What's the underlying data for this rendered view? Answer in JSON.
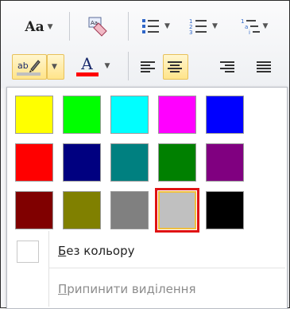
{
  "ribbon": {
    "font_size_label": "Aa",
    "font_color_letter": "A",
    "highlighter_label": "ab",
    "font_color_bar": "#ff0000",
    "highlight_bar": "#c0c0c0"
  },
  "palette": {
    "rows": [
      [
        {
          "name": "yellow",
          "color": "#ffff00"
        },
        {
          "name": "bright-green",
          "color": "#00ff00"
        },
        {
          "name": "turquoise",
          "color": "#00ffff"
        },
        {
          "name": "pink",
          "color": "#ff00ff"
        },
        {
          "name": "blue",
          "color": "#0000ff"
        }
      ],
      [
        {
          "name": "red",
          "color": "#ff0000"
        },
        {
          "name": "dark-blue",
          "color": "#000080"
        },
        {
          "name": "teal",
          "color": "#008080"
        },
        {
          "name": "green",
          "color": "#008000"
        },
        {
          "name": "violet",
          "color": "#800080"
        }
      ],
      [
        {
          "name": "dark-red",
          "color": "#800000"
        },
        {
          "name": "dark-yellow",
          "color": "#808000"
        },
        {
          "name": "gray-50",
          "color": "#808080"
        },
        {
          "name": "gray-25",
          "color": "#c0c0c0"
        },
        {
          "name": "black",
          "color": "#000000"
        }
      ]
    ],
    "selected": "gray-25"
  },
  "menu": {
    "no_color": {
      "first": "Б",
      "rest": "ез кольору"
    },
    "stop_highlighting": {
      "first": "П",
      "rest": "рипинити виділення"
    }
  }
}
